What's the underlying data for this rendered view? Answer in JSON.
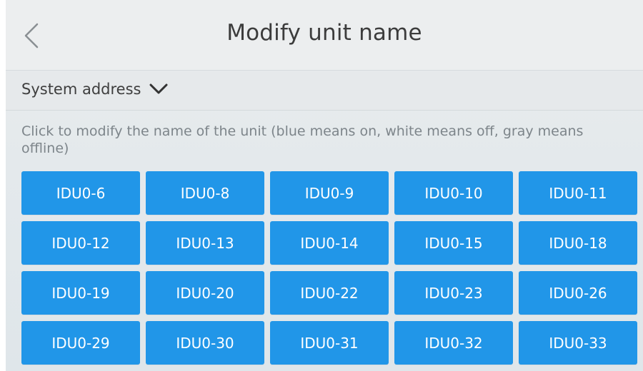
{
  "header": {
    "title": "Modify unit name",
    "back_icon": "chevron-left-icon"
  },
  "system": {
    "label": "System address",
    "dropdown_icon": "chevron-down-icon"
  },
  "hint": "Click to modify the name of the unit (blue means on, white means off, gray means offline)",
  "colors": {
    "on": "#2196e8",
    "off": "#ffffff",
    "offline": "#9e9e9e"
  },
  "units": [
    "IDU0-6",
    "IDU0-8",
    "IDU0-9",
    "IDU0-10",
    "IDU0-11",
    "IDU0-12",
    "IDU0-13",
    "IDU0-14",
    "IDU0-15",
    "IDU0-18",
    "IDU0-19",
    "IDU0-20",
    "IDU0-22",
    "IDU0-23",
    "IDU0-26",
    "IDU0-29",
    "IDU0-30",
    "IDU0-31",
    "IDU0-32",
    "IDU0-33"
  ]
}
